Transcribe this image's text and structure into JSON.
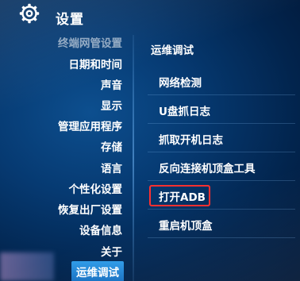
{
  "header": {
    "title": "设置",
    "icon": "gear-icon"
  },
  "left_menu": {
    "items": [
      {
        "label": "终端网管设置"
      },
      {
        "label": "日期和时间"
      },
      {
        "label": "声音"
      },
      {
        "label": "显示"
      },
      {
        "label": "管理应用程序"
      },
      {
        "label": "存储"
      },
      {
        "label": "语言"
      },
      {
        "label": "个性化设置"
      },
      {
        "label": "恢复出厂设置"
      },
      {
        "label": "设备信息"
      },
      {
        "label": "关于"
      },
      {
        "label": "运维调试"
      }
    ],
    "selected": "运维调试"
  },
  "right_panel": {
    "title": "运维调试",
    "items": [
      {
        "label": "网络检测"
      },
      {
        "label": "U盘抓日志"
      },
      {
        "label": "抓取开机日志"
      },
      {
        "label": "反向连接机顶盒工具"
      },
      {
        "label": "打开ADB"
      },
      {
        "label": "重启机顶盒"
      }
    ],
    "highlighted": "打开ADB"
  },
  "colors": {
    "background": "#063a72",
    "selected": "#1f86d6",
    "highlight_border": "#ff3030",
    "text": "#ffffff"
  }
}
